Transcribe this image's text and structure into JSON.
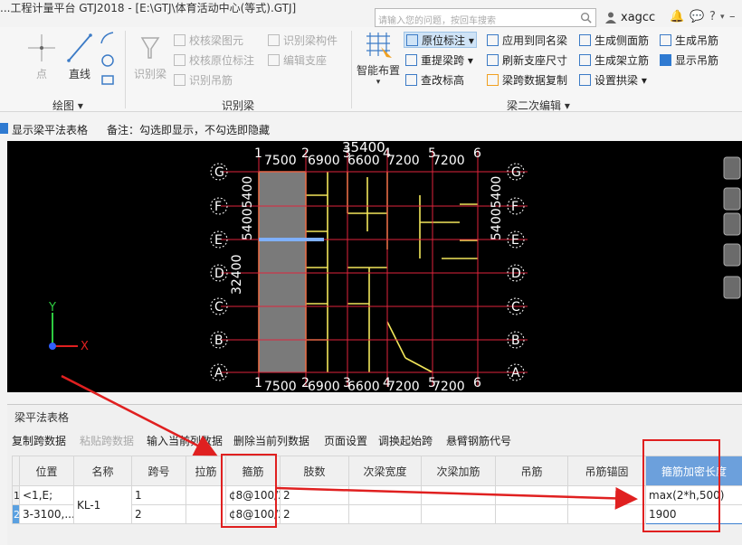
{
  "window": {
    "title": "...工程计量平台 GTJ2018 - [E:\\GTJ\\体育活动中心(等式).GTJ]"
  },
  "search": {
    "placeholder": "请输入您的问题，按回车搜索"
  },
  "user": {
    "name": "xagcc"
  },
  "ribbon": {
    "draw_group": {
      "label": "绘图",
      "point": "点",
      "line": "直线"
    },
    "identify_group": {
      "label": "识别梁",
      "identify_beam": "识别梁",
      "check_beam_drawing": "校核梁图元",
      "identify_beam_member": "识别梁构件",
      "check_original_annotation": "校核原位标注",
      "edit_support": "编辑支座",
      "identify_hanger": "识别吊筋"
    },
    "secondary_group": {
      "label": "梁二次编辑",
      "smart_layout": "智能布置",
      "original_annotation": "原位标注",
      "apply_same_name": "应用到同名梁",
      "re_extract_span": "重提梁跨",
      "refresh_support": "刷新支座尺寸",
      "change_elevation": "查改标高",
      "copy_span_data": "梁跨数据复制",
      "gen_side_bar": "生成侧面筋",
      "gen_stand_bar": "生成架立筋",
      "set_arch": "设置拱梁",
      "gen_hanger": "生成吊筋",
      "show_hanger": "显示吊筋"
    }
  },
  "options": {
    "show_table_label": "显示梁平法表格",
    "note": "备注：勾选即显示，不勾选即隐藏"
  },
  "canvas": {
    "top_dims": [
      "7500",
      "6900",
      "6600",
      "7200",
      "7200"
    ],
    "total_dim": "35400",
    "side_dim": "5400",
    "side_total": "32400",
    "col_labels": [
      "1",
      "2",
      "3",
      "4",
      "5",
      "6"
    ],
    "row_labels": [
      "G",
      "F",
      "E",
      "D",
      "C",
      "B",
      "A"
    ],
    "axis_x": "X",
    "axis_y": "Y"
  },
  "panel": {
    "title": "梁平法表格",
    "toolbar": [
      "复制跨数据",
      "粘贴跨数据",
      "输入当前列数据",
      "删除当前列数据",
      "页面设置",
      "调换起始跨",
      "悬臂钢筋代号"
    ],
    "columns": [
      "位置",
      "名称",
      "跨号",
      "拉筋",
      "箍筋",
      "肢数",
      "次梁宽度",
      "次梁加筋",
      "吊筋",
      "吊筋锚固",
      "箍筋加密长度"
    ],
    "rows": [
      {
        "num": "1",
        "position": "<1,E;",
        "name": "KL-1",
        "span": "1",
        "tie_bar": "",
        "stirrup": "¢8@100/2",
        "legs": "2",
        "sec_width": "",
        "sec_add": "",
        "hanger": "",
        "anchor": "",
        "dense_len": "max(2*h,500)"
      },
      {
        "num": "2",
        "position": "3-3100,...",
        "name": "",
        "span": "2",
        "tie_bar": "",
        "stirrup": "¢8@100/2",
        "legs": "2",
        "sec_width": "",
        "sec_add": "",
        "hanger": "",
        "anchor": "",
        "dense_len": "1900"
      }
    ]
  },
  "colors": {
    "accent": "#2f7ad1",
    "annotation": "#e02020",
    "canvas_bg": "#000000",
    "grid_line": "#e0243c",
    "beam_line": "#f2e65a"
  }
}
